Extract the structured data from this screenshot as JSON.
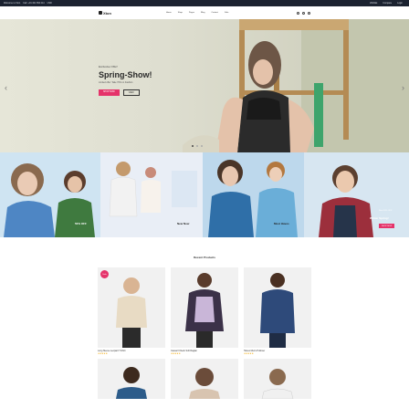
{
  "topbar": {
    "left_items": [
      "Welcome to Xton",
      "Call: +01 321 654 214",
      "USD"
    ],
    "right_items": [
      "Wishlist",
      "Compare",
      "Login"
    ]
  },
  "header": {
    "logo": "Xton",
    "nav": [
      "Home",
      "Shop",
      "Pages",
      "Blog",
      "Contact",
      "Sale"
    ],
    "cart_count": "0"
  },
  "hero": {
    "kicker": "Exclusive Offer!",
    "title": "Spring-Show!",
    "subtitle": "Limited offer: Take 70% on Fashion",
    "primary_button": "SHOP NOW",
    "secondary_button": "VIEW",
    "prev": "‹",
    "next": "›"
  },
  "banners": [
    {
      "title": "",
      "subtitle": "50% OFF"
    },
    {
      "title": "New Now",
      "subtitle": ""
    },
    {
      "title": "Must Haves",
      "subtitle": ""
    },
    {
      "title": "Winter Spring!",
      "subtitle": "New 30% OFF",
      "button": "SHOP NOW"
    }
  ],
  "section": {
    "title": "Recent Products"
  },
  "products": [
    {
      "name": "Long Sleeve Leopard T-Shirt",
      "stars": "★★★★★",
      "sale": "Sale"
    },
    {
      "name": "Causal V-Neck Soft Raglan",
      "stars": "★★★★★",
      "sale": ""
    },
    {
      "name": "Hanes Men's Pullover",
      "stars": "★★★★★",
      "sale": ""
    },
    {
      "name": "",
      "stars": "",
      "sale": ""
    },
    {
      "name": "",
      "stars": "",
      "sale": ""
    },
    {
      "name": "",
      "stars": "",
      "sale": ""
    }
  ],
  "colors": {
    "accent": "#e5336a",
    "topbar": "#1b2230",
    "hero_bg": "#deded0"
  }
}
